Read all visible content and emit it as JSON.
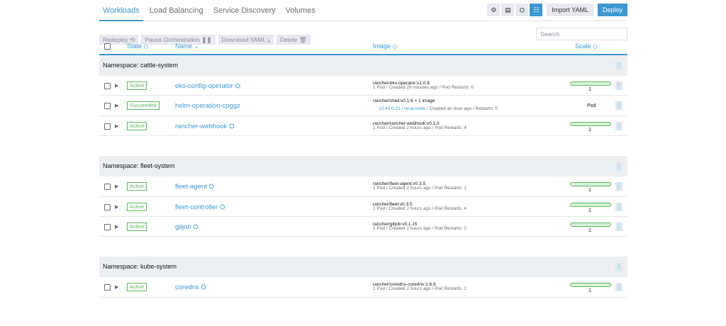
{
  "tabs": [
    "Workloads",
    "Load Balancing",
    "Service Discovery",
    "Volumes"
  ],
  "toolbar": {
    "view_icons": [
      "gear-icon",
      "list-icon",
      "folder-icon",
      "node-icon"
    ],
    "import_label": "Import YAML",
    "deploy_label": "Deploy"
  },
  "actions": {
    "redeploy": "Redeploy ⟲",
    "pause": "Pause Orchestration ❚❚",
    "download": "Download YAML ⤓",
    "delete": "Delete 🗑",
    "search_placeholder": "Search"
  },
  "columns": {
    "state": "State ◇",
    "name": "Name ⌄",
    "image": "Image ◇",
    "scale": "Scale ◇"
  },
  "accent_color": "#3d98d3",
  "active_color": "#5db85d",
  "groups": [
    {
      "label": "Namespace: cattle-system",
      "rows": [
        {
          "state": "Active",
          "name": "eks-config-operator ⛭",
          "image": "rancher/eks-operator:v1.0.8",
          "detail": "1 Pod / Created 29 minutes ago / Pod Restarts: 0",
          "scale": "1"
        },
        {
          "state": "Succeeded",
          "name": "helm-operation-cpggz",
          "image": "rancher/shell:v0.1.6 + 1 image",
          "detail_link1": "10.42.0.21",
          "detail_link2": "local-node",
          "detail_tail": " / Created an hour ago / Restarts: 0",
          "scale": "Pod"
        },
        {
          "state": "Active",
          "name": "rancher-webhook ⛭",
          "image": "rancher/rancher-webhook:v0.1.0",
          "detail": "1 Pod / Created 2 hours ago / Pod Restarts: 4",
          "scale": "1"
        }
      ]
    },
    {
      "label": "Namespace: fleet-system",
      "rows": [
        {
          "state": "Active",
          "name": "fleet-agent ⛭",
          "image": "rancher/fleet-agent:v0.3.5",
          "detail": "1 Pod / Created 2 hours ago / Pod Restarts: 1",
          "scale": "1"
        },
        {
          "state": "Active",
          "name": "fleet-controller ⛭",
          "image": "rancher/fleet:v0.3.5",
          "detail": "1 Pod / Created 2 hours ago / Pod Restarts: 4",
          "scale": "1"
        },
        {
          "state": "Active",
          "name": "gitjob ⛭",
          "image": "rancher/gitjob:v0.1.15",
          "detail": "1 Pod / Created 2 hours ago / Pod Restarts: 2",
          "scale": "1"
        }
      ]
    },
    {
      "label": "Namespace: kube-system",
      "rows": [
        {
          "state": "Active",
          "name": "coredns ⛭",
          "image": "rancher/coredns-coredns:1.6.9",
          "detail": "1 Pod / Created 2 hours ago / Pod Restarts: 2",
          "scale": "1"
        }
      ]
    }
  ]
}
